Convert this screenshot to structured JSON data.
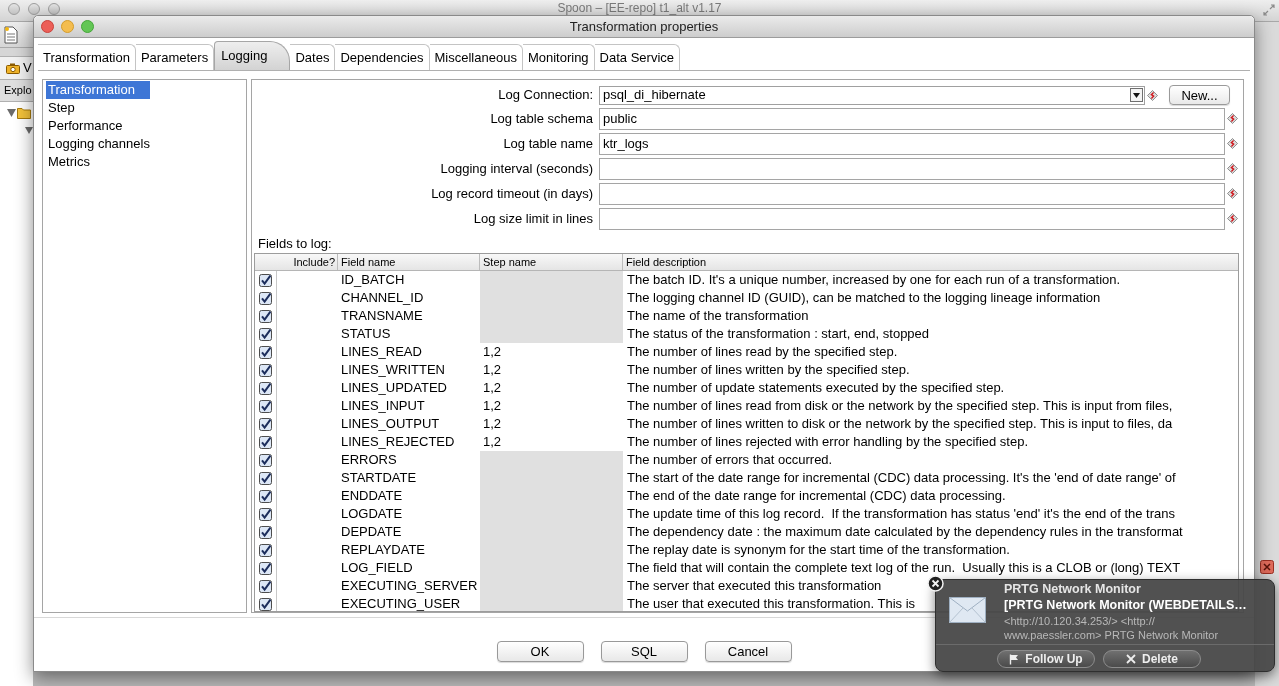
{
  "spoon": {
    "title": "Spoon – [EE-repo] t1_alt v1.17",
    "tab_fragment": "V",
    "panel_fragment": "Explo"
  },
  "dialog": {
    "title": "Transformation properties",
    "tabs": [
      {
        "label": "Transformation",
        "selected": false
      },
      {
        "label": "Parameters",
        "selected": false
      },
      {
        "label": "Logging",
        "selected": true
      },
      {
        "label": "Dates",
        "selected": false
      },
      {
        "label": "Dependencies",
        "selected": false
      },
      {
        "label": "Miscellaneous",
        "selected": false
      },
      {
        "label": "Monitoring",
        "selected": false
      },
      {
        "label": "Data Service",
        "selected": false
      }
    ],
    "sections": [
      {
        "label": "Transformation",
        "selected": true
      },
      {
        "label": "Step",
        "selected": false
      },
      {
        "label": "Performance",
        "selected": false
      },
      {
        "label": "Logging channels",
        "selected": false
      },
      {
        "label": "Metrics",
        "selected": false
      }
    ],
    "log_connection": {
      "label": "Log Connection:",
      "value": "psql_di_hibernate",
      "new_button": "New..."
    },
    "fields": [
      {
        "label": "Log table schema",
        "value": "public"
      },
      {
        "label": "Log table name",
        "value": "ktr_logs"
      },
      {
        "label": "Logging interval (seconds)"
      },
      {
        "label": "Log record timeout (in days)"
      },
      {
        "label": "Log size limit in lines"
      }
    ],
    "fields_to_log": {
      "title": "Fields to log:",
      "columns": [
        "Include?",
        "Field name",
        "Step name",
        "Field description"
      ],
      "rows": [
        {
          "checked": true,
          "field_name": "ID_BATCH",
          "step_disabled": true,
          "description": "The batch ID. It's a unique number, increased by one for each run of a transformation."
        },
        {
          "checked": true,
          "field_name": "CHANNEL_ID",
          "step_disabled": true,
          "description": "The logging channel ID (GUID), can be matched to the logging lineage information"
        },
        {
          "checked": true,
          "field_name": "TRANSNAME",
          "step_disabled": true,
          "description": "The name of the transformation"
        },
        {
          "checked": true,
          "field_name": "STATUS",
          "step_disabled": true,
          "description": "The status of the transformation : start, end, stopped"
        },
        {
          "checked": true,
          "field_name": "LINES_READ",
          "step_name": "1,2",
          "step_disabled": false,
          "description": "The number of lines read by the specified step."
        },
        {
          "checked": true,
          "field_name": "LINES_WRITTEN",
          "step_name": "1,2",
          "step_disabled": false,
          "description": "The number of lines written by the specified step."
        },
        {
          "checked": true,
          "field_name": "LINES_UPDATED",
          "step_name": "1,2",
          "step_disabled": false,
          "description": "The number of update statements executed by the specified step."
        },
        {
          "checked": true,
          "field_name": "LINES_INPUT",
          "step_name": "1,2",
          "step_disabled": false,
          "description": "The number of lines read from disk or the network by the specified step. This is input from files,"
        },
        {
          "checked": true,
          "field_name": "LINES_OUTPUT",
          "step_name": "1,2",
          "step_disabled": false,
          "description": "The number of lines written to disk or the network by the specified step. This is input to files, da"
        },
        {
          "checked": true,
          "field_name": "LINES_REJECTED",
          "step_name": "1,2",
          "step_disabled": false,
          "description": "The number of lines rejected with error handling by the specified step."
        },
        {
          "checked": true,
          "field_name": "ERRORS",
          "step_disabled": true,
          "description": "The number of errors that occurred."
        },
        {
          "checked": true,
          "field_name": "STARTDATE",
          "step_disabled": true,
          "description": "The start of the date range for incremental (CDC) data processing. It's the 'end of date range' of"
        },
        {
          "checked": true,
          "field_name": "ENDDATE",
          "step_disabled": true,
          "description": "The end of the date range for incremental (CDC) data processing."
        },
        {
          "checked": true,
          "field_name": "LOGDATE",
          "step_disabled": true,
          "description": "The update time of this log record.  If the transformation has status 'end' it's the end of the trans"
        },
        {
          "checked": true,
          "field_name": "DEPDATE",
          "step_disabled": true,
          "description": "The dependency date : the maximum date calculated by the dependency rules in the transformat"
        },
        {
          "checked": true,
          "field_name": "REPLAYDATE",
          "step_disabled": true,
          "description": "The replay date is synonym for the start time of the transformation."
        },
        {
          "checked": true,
          "field_name": "LOG_FIELD",
          "step_disabled": true,
          "description": "The field that will contain the complete text log of the run.  Usually this is a CLOB or (long) TEXT"
        },
        {
          "checked": true,
          "field_name": "EXECUTING_SERVER",
          "step_disabled": true,
          "description": "The server that executed this transformation"
        },
        {
          "checked": true,
          "field_name": "EXECUTING_USER",
          "step_disabled": true,
          "description": "The user that executed this transformation. This is"
        }
      ]
    },
    "buttons": [
      "OK",
      "SQL",
      "Cancel"
    ]
  },
  "notification": {
    "app": "PRTG Network Monitor",
    "subject": "[PRTG Network Monitor (WEBDETAILS…",
    "body_lines": [
      "<http://10.120.34.253/> <http://",
      "www.paessler.com> PRTG Network Monitor"
    ],
    "actions": [
      {
        "label": "Follow Up",
        "kind": "flag"
      },
      {
        "label": "Delete",
        "kind": "delete"
      }
    ]
  }
}
